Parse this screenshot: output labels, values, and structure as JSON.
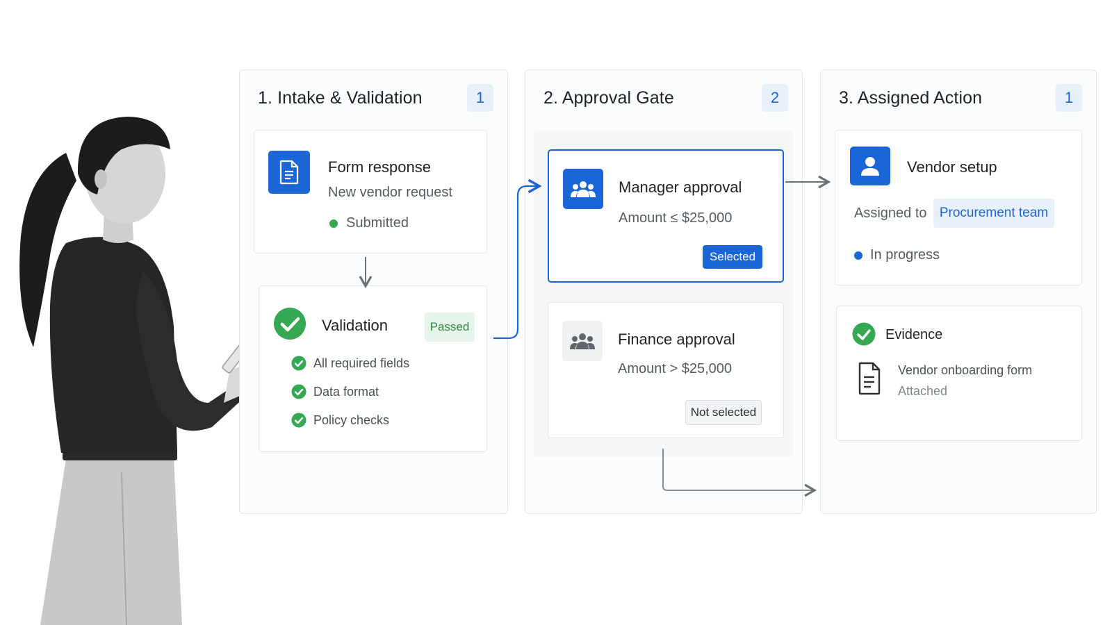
{
  "columns": [
    {
      "title": "1. Intake & Validation",
      "count": "1",
      "form_card": {
        "title": "Form response",
        "subtitle": "New vendor request",
        "status": "Submitted",
        "icon": "document-icon"
      },
      "validation_card": {
        "title": "Validation",
        "badge": "Passed",
        "icon": "check-circle-icon",
        "checks": [
          "All required fields",
          "Data format",
          "Policy checks"
        ]
      }
    },
    {
      "title": "2. Approval Gate",
      "count": "2",
      "manager_card": {
        "title": "Manager approval",
        "condition": "Amount ≤ $25,000",
        "badge": "Selected",
        "icon": "group-icon"
      },
      "finance_card": {
        "title": "Finance approval",
        "condition": "Amount > $25,000",
        "badge": "Not selected",
        "icon": "group-icon"
      }
    },
    {
      "title": "3. Assigned Action",
      "count": "1",
      "vendor_card": {
        "title": "Vendor setup",
        "assigned_label": "Assigned to",
        "assignee": "Procurement team",
        "status": "In progress",
        "icon": "user-icon"
      },
      "evidence_card": {
        "title": "Evidence",
        "file_name": "Vendor onboarding form",
        "file_status": "Attached",
        "icon": "document-outline-icon"
      }
    }
  ],
  "colors": {
    "accent": "#1a66d6",
    "success": "#34a853",
    "passed_bg": "#e7f4ea",
    "chip_bg": "#e8f0fb"
  }
}
